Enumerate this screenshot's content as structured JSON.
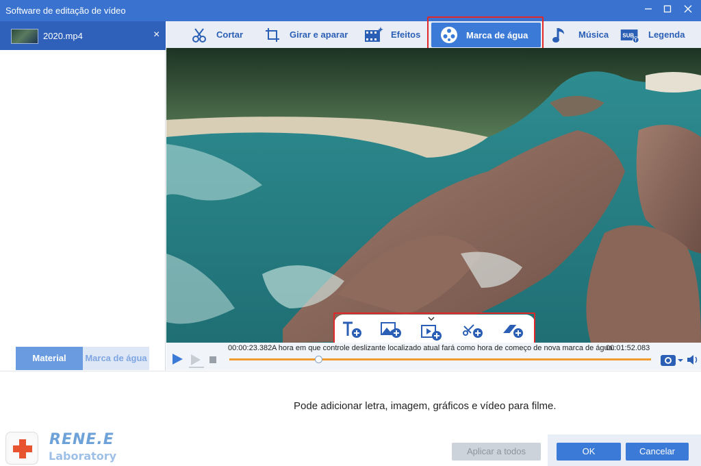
{
  "window": {
    "title": "Software de editação de vídeo",
    "buttons": {
      "minimize": "—",
      "maximize": "☐",
      "close": "✕"
    }
  },
  "left_panel": {
    "file": {
      "name": "2020.mp4",
      "close": "×"
    },
    "tabs": [
      {
        "label": "Material",
        "active": true
      },
      {
        "label": "Marca de água",
        "active": false
      }
    ]
  },
  "toolbar": {
    "items": [
      {
        "label": "Cortar",
        "icon": "scissors-icon"
      },
      {
        "label": "Girar e aparar",
        "icon": "rotate-crop-icon"
      },
      {
        "label": "Efeitos",
        "icon": "effects-film-icon"
      },
      {
        "label": "Marca de água",
        "icon": "watermark-reel-icon",
        "active": true
      },
      {
        "label": "Música",
        "icon": "music-note-icon"
      },
      {
        "label": "Legenda",
        "icon": "subtitle-icon"
      }
    ]
  },
  "watermark_tools": [
    {
      "name": "add-text-watermark",
      "icon": "text-plus-icon"
    },
    {
      "name": "add-image-watermark",
      "icon": "image-plus-icon"
    },
    {
      "name": "add-video-watermark",
      "icon": "video-plus-icon"
    },
    {
      "name": "add-graphic-watermark",
      "icon": "shape-plus-icon"
    },
    {
      "name": "erase-watermark",
      "icon": "eraser-plus-icon"
    }
  ],
  "player": {
    "current_time": "00:00:23.382",
    "tip": "A hora em que controle deslizante localizado atual fará como hora de começo de nova marca de água.",
    "total_time": "00:01:52.083",
    "progress_fraction": 0.215
  },
  "footer": {
    "hint": "Pode adicionar letra, imagem, gráficos e vídeo para filme.",
    "apply_all": "Aplicar a todos",
    "ok": "OK",
    "cancel": "Cancelar"
  },
  "logo": {
    "brand": "RENE.E",
    "sub": "Laboratory"
  },
  "colors": {
    "accent": "#3b7ad6",
    "titlebar": "#3a73cf",
    "highlight": "#e12727",
    "progress": "#f29a2e"
  }
}
